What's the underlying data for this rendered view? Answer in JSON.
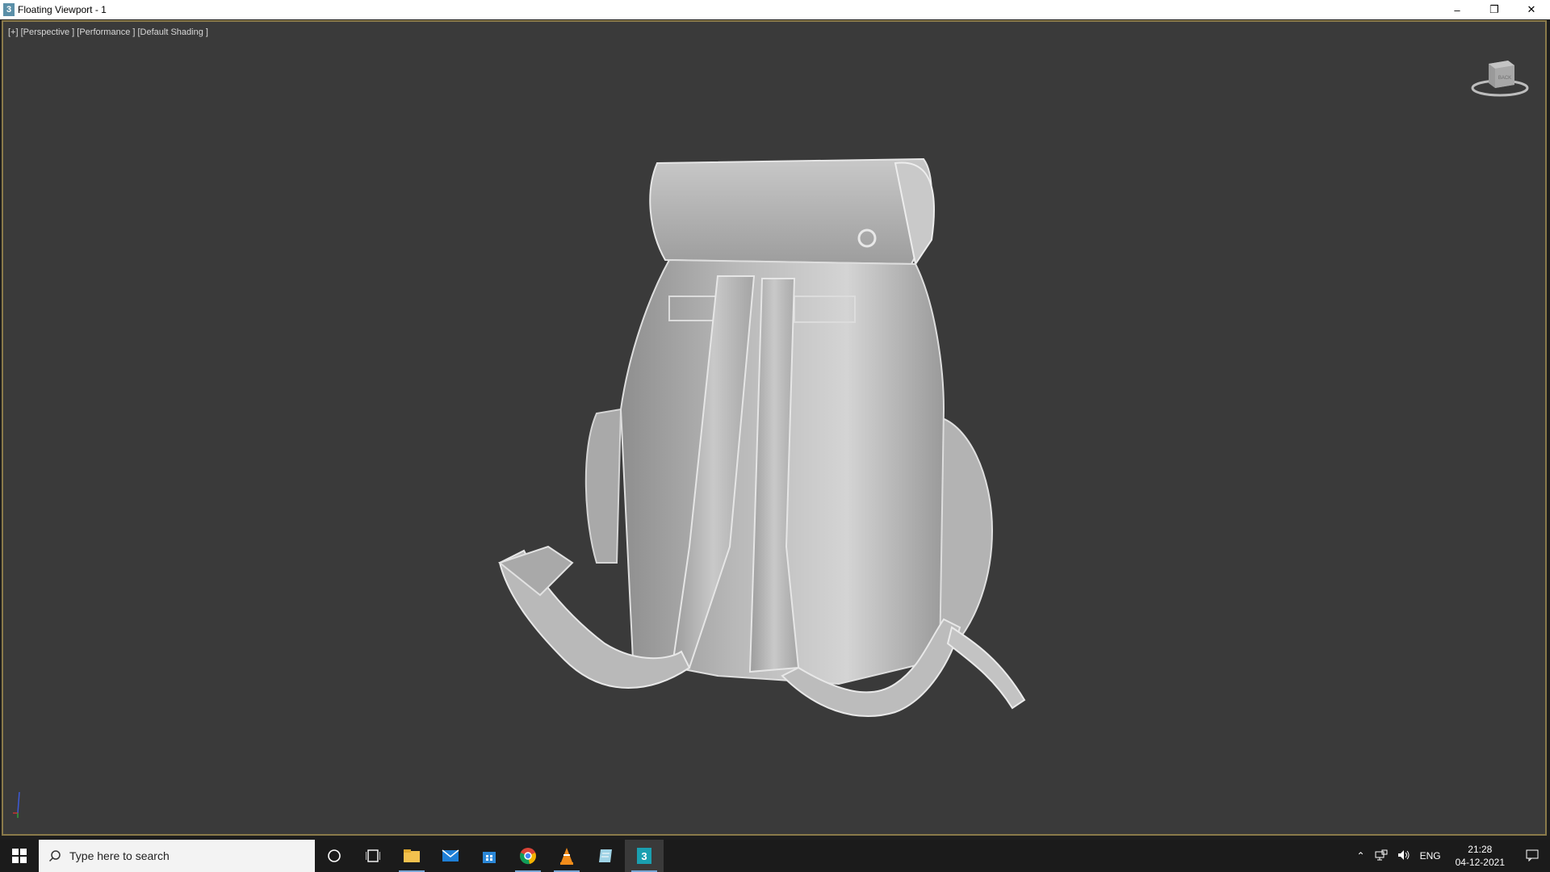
{
  "window": {
    "title": "Floating Viewport - 1",
    "app_icon_label": "3",
    "minimize": "–",
    "restore": "❐",
    "close": "✕"
  },
  "viewport": {
    "label": "[+] [Perspective ] [Performance ] [Default Shading ]",
    "viewcube_face": "BACK",
    "model": "backpack-mesh"
  },
  "taskbar": {
    "search_placeholder": "Type here to search",
    "apps": [
      {
        "name": "cortana-icon"
      },
      {
        "name": "task-view-icon"
      },
      {
        "name": "file-explorer-icon"
      },
      {
        "name": "mail-icon"
      },
      {
        "name": "store-icon"
      },
      {
        "name": "chrome-icon"
      },
      {
        "name": "vlc-icon"
      },
      {
        "name": "notepad-icon"
      },
      {
        "name": "3dsmax-icon"
      }
    ],
    "tray": {
      "language": "ENG",
      "time": "21:28",
      "date": "04-12-2021"
    }
  },
  "colors": {
    "viewport_bg": "#3a3a3a",
    "border_accent": "#8a7a4a",
    "taskbar_bg": "#1b1b1b",
    "active_underline": "#7aa7d6"
  }
}
